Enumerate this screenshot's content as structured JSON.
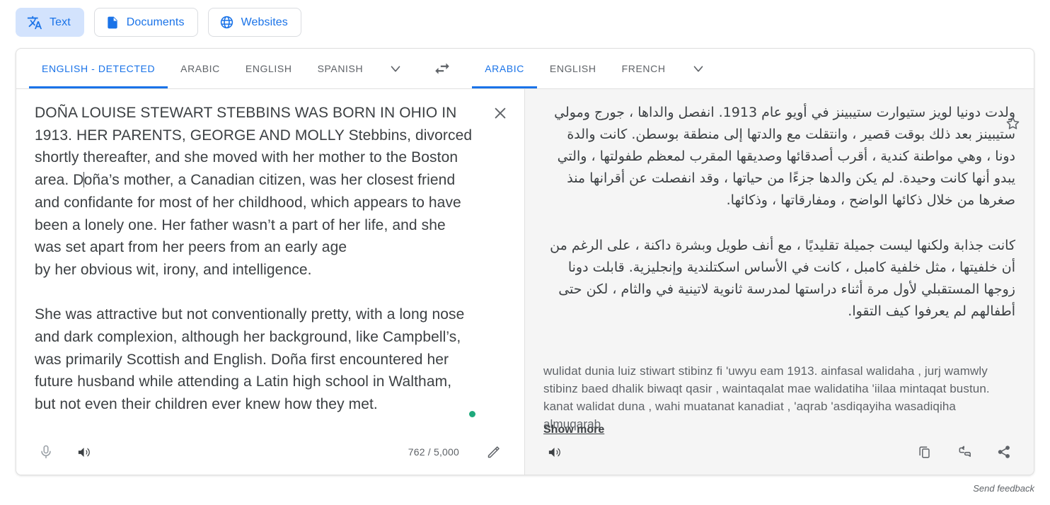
{
  "mode_tabs": [
    {
      "label": "Text",
      "icon": "translate-icon",
      "active": true
    },
    {
      "label": "Documents",
      "icon": "document-icon",
      "active": false
    },
    {
      "label": "Websites",
      "icon": "globe-icon",
      "active": false
    }
  ],
  "source_panel": {
    "languages": [
      {
        "label": "ENGLISH - DETECTED",
        "active": true
      },
      {
        "label": "ARABIC",
        "active": false
      },
      {
        "label": "ENGLISH",
        "active": false
      },
      {
        "label": "SPANISH",
        "active": false
      }
    ],
    "more_icon": "chevron-down-icon",
    "clear_icon": "close-icon",
    "paragraph_1": "DOÑA LOUISE STEWART STEBBINS WAS BORN IN OHIO IN 1913. HER PARENTS, GEORGE AND MOLLY Stebbins, divorced shortly thereafter, and she moved with her mother to the Boston area. D",
    "paragraph_1_rest": "oña’s mother, a Canadian citizen, was her closest friend and confidante for most of her childhood, which appears to have been a lonely one. Her father wasn’t a part of her life, and she was set apart from her peers from an early age",
    "paragraph_2": "by her obvious wit, irony, and intelligence.",
    "paragraph_3": "She was attractive but not conventionally pretty, with a long nose and dark complexion, although her background, like Campbell’s, was primarily Scottish and English. Doña first encountered her future husband while attending a Latin high school in Waltham, but not even their children ever knew how they met.",
    "mic_icon": "microphone-icon",
    "speaker_icon": "speaker-icon",
    "char_count": "762 / 5,000",
    "edit_icon": "pencil-icon",
    "activity_dot_color": "#1ea97c"
  },
  "swap": {
    "icon": "swap-languages-icon"
  },
  "target_panel": {
    "languages": [
      {
        "label": "ARABIC",
        "active": true
      },
      {
        "label": "ENGLISH",
        "active": false
      },
      {
        "label": "FRENCH",
        "active": false
      }
    ],
    "more_icon": "chevron-down-icon",
    "star_icon": "star-outline-icon",
    "paragraph_1": "ولدت دونيا لويز ستيوارت ستيبينز في أويو عام 1913. انفصل والداها ، جورج ومولي ستيبينز بعد ذلك بوقت قصير ، وانتقلت مع والدتها إلى منطقة بوسطن. كانت والدة دونا ، وهي مواطنة كندية ، أقرب أصدقائها وصديقها المقرب لمعظم طفولتها ، والتي يبدو أنها كانت وحيدة. لم يكن والدها جزءًا من حياتها ، وقد انفصلت عن أقرانها منذ صغرها من خلال ذكائها الواضح ، ومفارقاتها ، وذكائها.",
    "paragraph_2": "كانت جذابة ولكنها ليست جميلة تقليديًا ، مع أنف طويل وبشرة داكنة ، على الرغم من أن خلفيتها ، مثل خلفية كامبل ، كانت في الأساس اسكتلندية وإنجليزية. قابلت دونا زوجها المستقبلي لأول مرة أثناء دراستها لمدرسة ثانوية لاتينية في والثام ، لكن حتى أطفالهم لم يعرفوا كيف التقوا.",
    "transliteration": "wulidat dunia luiz stiwart stibinz fi 'uwyu eam 1913. ainfasal walidaha , jurj wamwly stibinz baed dhalik biwaqt qasir , waintaqalat mae walidatiha 'iilaa mintaqat bustun. kanat walidat duna , wahi muatanat kanadiat , 'aqrab 'asdiqayiha wasadiqiha almuqarab",
    "show_more_label": "Show more",
    "speaker_icon": "speaker-icon",
    "copy_icon": "copy-icon",
    "suggest_edit_icon": "suggest-edit-icon",
    "share_icon": "share-icon"
  },
  "footer": {
    "send_feedback": "Send feedback"
  },
  "colors": {
    "accent": "#1a73e8",
    "chip_active_bg": "#d3e3fd",
    "target_bg": "#f5f5f5",
    "text": "#3c4043",
    "muted": "#5f6368"
  }
}
